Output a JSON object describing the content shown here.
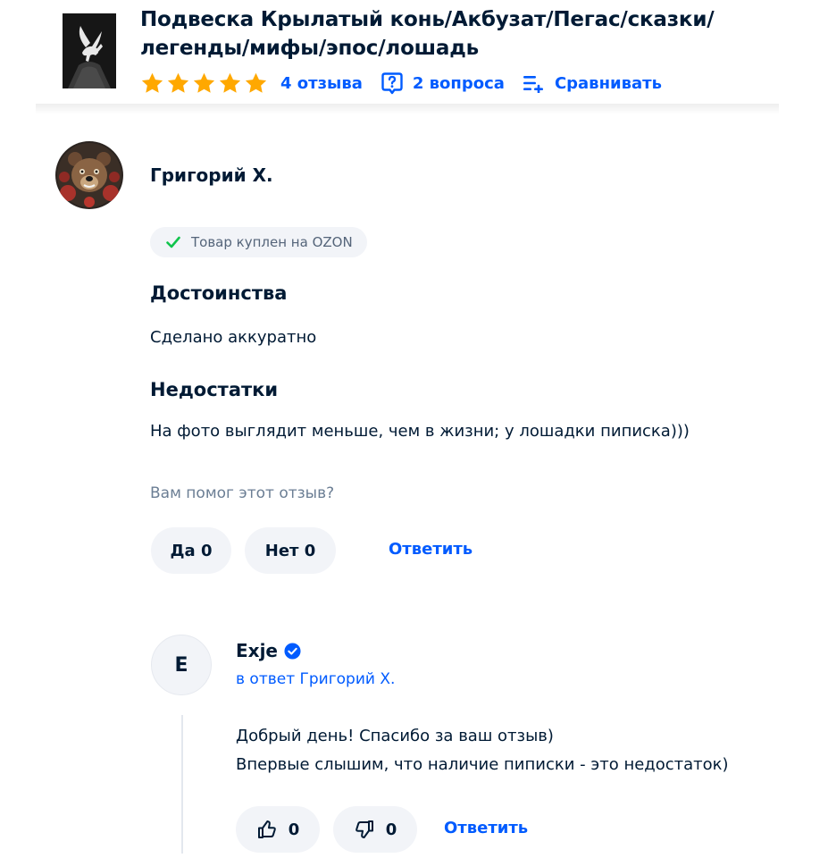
{
  "product": {
    "title_line1": "Подвеска Крылатый конь/Акбузат/Пегас/сказки/",
    "title_line2": "легенды/мифы/эпос/лошадь",
    "rating_stars": 5,
    "reviews_link": "4 отзыва",
    "questions_link": "2 вопроса",
    "compare_link": "Сравнивать"
  },
  "review": {
    "author": "Григорий Х.",
    "purchase_badge": "Товар куплен на OZON",
    "pros_heading": "Достоинства",
    "pros_text": "Сделано аккуратно",
    "cons_heading": "Недостатки",
    "cons_text": "На фото выглядит меньше, чем в жизни; у лошадки пиписка)))",
    "helpful_question": "Вам помог этот отзыв?",
    "yes_button": "Да 0",
    "no_button": "Нет 0",
    "reply_button": "Ответить"
  },
  "seller_reply": {
    "avatar_letter": "E",
    "name": "Exje",
    "in_reply_to": "в ответ Григорий Х.",
    "text_line1": "Добрый день! Спасибо за ваш отзыв)",
    "text_line2": "Впервые слышим, что наличие пиписки - это недостаток)",
    "like_count": "0",
    "dislike_count": "0",
    "reply_button": "Ответить"
  },
  "colors": {
    "accent": "#005bff",
    "star": "#ffa800",
    "text": "#001a34",
    "muted": "#6b7e94",
    "pill_bg": "#f2f4f8",
    "check": "#10c44c"
  },
  "icons": [
    "star-icon",
    "question-icon",
    "compare-icon",
    "checkmark-icon",
    "verified-icon",
    "thumbs-up-icon",
    "thumbs-down-icon"
  ]
}
